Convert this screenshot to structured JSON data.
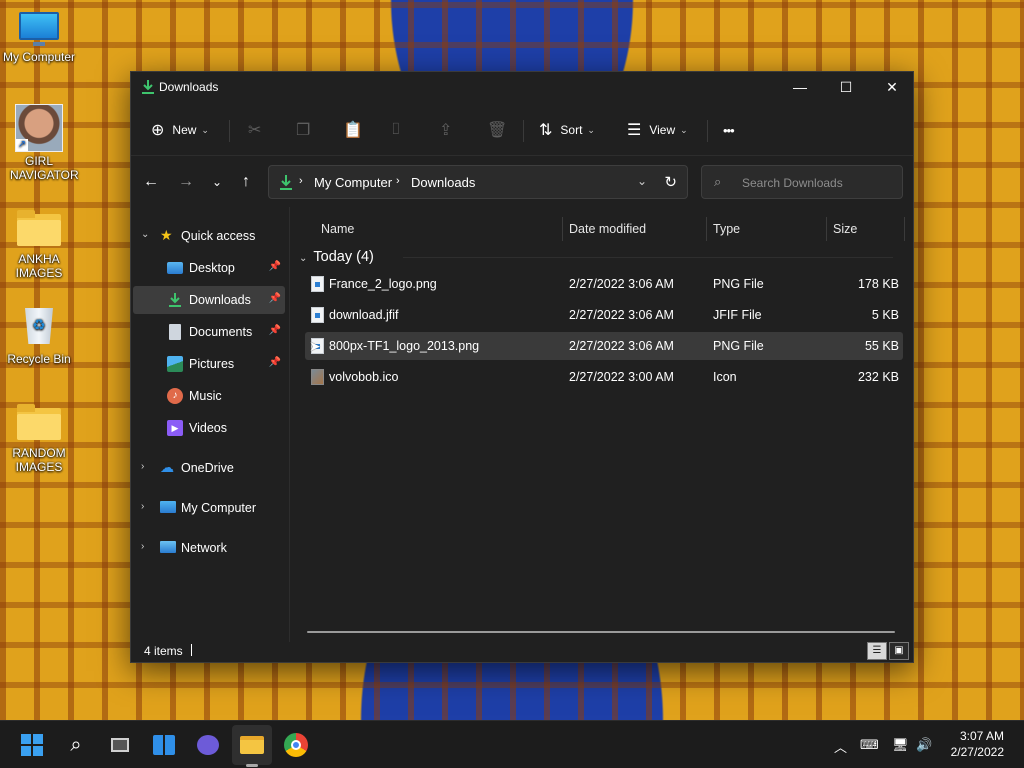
{
  "desktop": {
    "icons": [
      {
        "label": "My Computer"
      },
      {
        "label": "GIRL NAVIGATOR"
      },
      {
        "label": "ANKHA IMAGES"
      },
      {
        "label": "Recycle Bin"
      },
      {
        "label": "RANDOM IMAGES"
      }
    ]
  },
  "window": {
    "title": "Downloads",
    "controls": {
      "minimize": "—",
      "maximize": "☐",
      "close": "✕"
    }
  },
  "toolbar": {
    "new_label": "New",
    "sort_label": "Sort",
    "view_label": "View",
    "more_label": "•••"
  },
  "addressbar": {
    "crumbs": [
      "My Computer",
      "Downloads"
    ]
  },
  "search": {
    "placeholder": "Search Downloads"
  },
  "navpane": {
    "quick_access": "Quick access",
    "items": [
      {
        "label": "Desktop",
        "pinned": true
      },
      {
        "label": "Downloads",
        "pinned": true,
        "selected": true
      },
      {
        "label": "Documents",
        "pinned": true
      },
      {
        "label": "Pictures",
        "pinned": true
      },
      {
        "label": "Music",
        "pinned": false
      },
      {
        "label": "Videos",
        "pinned": false
      }
    ],
    "roots": [
      {
        "label": "OneDrive"
      },
      {
        "label": "My Computer"
      },
      {
        "label": "Network"
      }
    ]
  },
  "filelist": {
    "columns": [
      "Name",
      "Date modified",
      "Type",
      "Size"
    ],
    "group": "Today (4)",
    "rows": [
      {
        "name": "France_2_logo.png",
        "date": "2/27/2022 3:06 AM",
        "type": "PNG File",
        "size": "178 KB"
      },
      {
        "name": "download.jfif",
        "date": "2/27/2022 3:06 AM",
        "type": "JFIF File",
        "size": "5 KB"
      },
      {
        "name": "800px-TF1_logo_2013.png",
        "date": "2/27/2022 3:06 AM",
        "type": "PNG File",
        "size": "55 KB",
        "selected": true
      },
      {
        "name": "volvobob.ico",
        "date": "2/27/2022 3:00 AM",
        "type": "Icon",
        "size": "232 KB"
      }
    ]
  },
  "statusbar": {
    "count": "4 items"
  },
  "taskbar": {
    "time": "3:07 AM",
    "date": "2/27/2022"
  },
  "colors": {
    "window_bg": "#202020",
    "selection": "#3d3d3d",
    "taskbar_bg": "#1c1c1c",
    "desktop_bg": "#e0a21c"
  }
}
